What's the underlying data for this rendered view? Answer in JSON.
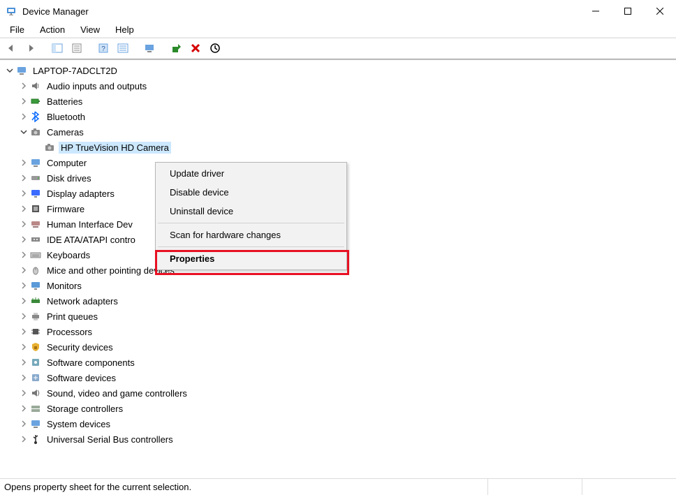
{
  "window": {
    "title": "Device Manager"
  },
  "menubar": [
    "File",
    "Action",
    "View",
    "Help"
  ],
  "tree": {
    "root": "LAPTOP-7ADCLT2D",
    "categories": [
      {
        "label": "Audio inputs and outputs",
        "icon": "speaker"
      },
      {
        "label": "Batteries",
        "icon": "battery"
      },
      {
        "label": "Bluetooth",
        "icon": "bluetooth"
      },
      {
        "label": "Cameras",
        "icon": "camera",
        "expanded": true,
        "children": [
          {
            "label": "HP TrueVision HD Camera",
            "icon": "camera",
            "selected": true
          }
        ]
      },
      {
        "label": "Computer",
        "icon": "computer"
      },
      {
        "label": "Disk drives",
        "icon": "disk"
      },
      {
        "label": "Display adapters",
        "icon": "display"
      },
      {
        "label": "Firmware",
        "icon": "firmware"
      },
      {
        "label": "Human Interface Devices",
        "icon": "hid",
        "truncated": "Human Interface Dev"
      },
      {
        "label": "IDE ATA/ATAPI controllers",
        "icon": "ide",
        "truncated": "IDE ATA/ATAPI contro"
      },
      {
        "label": "Keyboards",
        "icon": "keyboard"
      },
      {
        "label": "Mice and other pointing devices",
        "icon": "mouse"
      },
      {
        "label": "Monitors",
        "icon": "monitor"
      },
      {
        "label": "Network adapters",
        "icon": "network"
      },
      {
        "label": "Print queues",
        "icon": "printer"
      },
      {
        "label": "Processors",
        "icon": "cpu"
      },
      {
        "label": "Security devices",
        "icon": "security"
      },
      {
        "label": "Software components",
        "icon": "swcomp"
      },
      {
        "label": "Software devices",
        "icon": "swdev"
      },
      {
        "label": "Sound, video and game controllers",
        "icon": "sound"
      },
      {
        "label": "Storage controllers",
        "icon": "storage"
      },
      {
        "label": "System devices",
        "icon": "system"
      },
      {
        "label": "Universal Serial Bus controllers",
        "icon": "usb"
      }
    ]
  },
  "context_menu": {
    "items": [
      {
        "label": "Update driver"
      },
      {
        "label": "Disable device"
      },
      {
        "label": "Uninstall device"
      },
      {
        "sep": true
      },
      {
        "label": "Scan for hardware changes"
      },
      {
        "sep": true
      },
      {
        "label": "Properties",
        "bold": true
      }
    ]
  },
  "statusbar": {
    "text": "Opens property sheet for the current selection."
  },
  "toolbar_buttons": [
    "back",
    "forward",
    "sep",
    "show-all",
    "sep",
    "help",
    "action",
    "sep",
    "monitor",
    "sep",
    "update",
    "uninstall",
    "scan"
  ]
}
